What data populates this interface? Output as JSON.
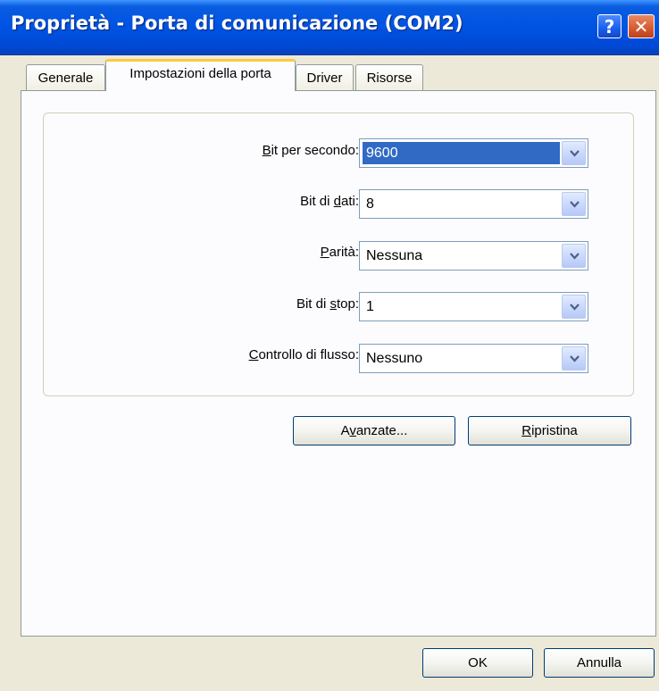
{
  "window": {
    "title": "Proprietà - Porta di comunicazione (COM2)"
  },
  "titlebar_buttons": {
    "help": "?",
    "close": "✕"
  },
  "tabs": [
    {
      "label": "Generale",
      "active": false
    },
    {
      "label": "Impostazioni della porta",
      "active": true
    },
    {
      "label": "Driver",
      "active": false
    },
    {
      "label": "Risorse",
      "active": false
    }
  ],
  "settings": {
    "bits_per_second": {
      "label_pre": "",
      "label_key": "B",
      "label_post": "it per secondo:",
      "value": "9600"
    },
    "data_bits": {
      "label_pre": "Bit di ",
      "label_key": "d",
      "label_post": "ati:",
      "value": "8"
    },
    "parity": {
      "label_pre": "",
      "label_key": "P",
      "label_post": "arità:",
      "value": "Nessuna"
    },
    "stop_bits": {
      "label_pre": "Bit di ",
      "label_key": "s",
      "label_post": "top:",
      "value": "1"
    },
    "flow_control": {
      "label_pre": "",
      "label_key": "C",
      "label_post": "ontrollo di flusso:",
      "value": "Nessuno"
    }
  },
  "buttons": {
    "advanced": {
      "pre": "A",
      "key": "v",
      "post": "anzate..."
    },
    "restore": {
      "pre": "",
      "key": "R",
      "post": "ipristina"
    },
    "ok": "OK",
    "cancel": "Annulla"
  },
  "colors": {
    "titlebar": "#0054e3",
    "dialog_bg": "#ece9d8",
    "panel_bg": "#fcfcfe",
    "selection": "#316ac5",
    "active_tab_accent": "#ffc83c",
    "close_button": "#d75a2e"
  },
  "icons": {
    "dropdown": "chevron-down-icon",
    "help": "help-icon",
    "close": "close-icon"
  }
}
